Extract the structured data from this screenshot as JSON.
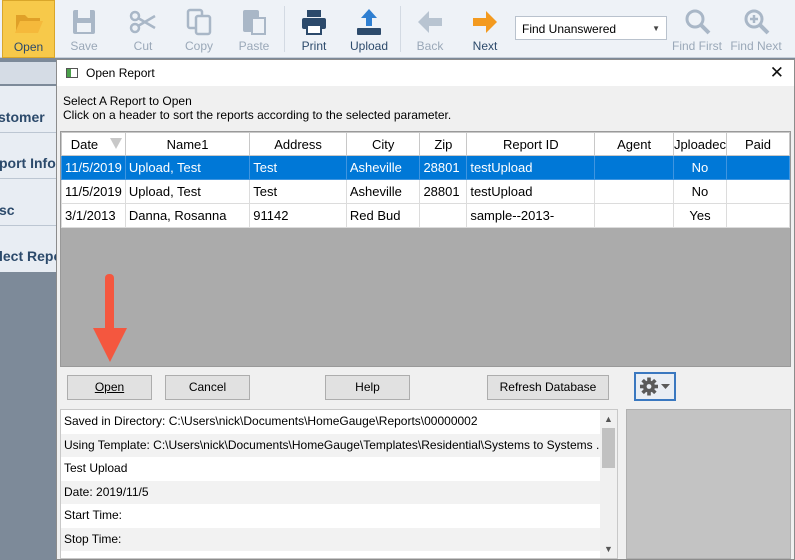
{
  "toolbar": {
    "open": "Open",
    "save": "Save",
    "cut": "Cut",
    "copy": "Copy",
    "paste": "Paste",
    "print": "Print",
    "upload": "Upload",
    "back": "Back",
    "next": "Next",
    "find_select_value": "Find Unanswered",
    "find_first": "Find First",
    "find_next": "Find Next"
  },
  "left_nav": {
    "items": [
      "stomer",
      "port Info",
      "sc",
      "lect Repo"
    ]
  },
  "dialog": {
    "title": "Open Report",
    "instruction_line1": "Select A Report to Open",
    "instruction_line2": "Click on a header to sort the reports according to the selected parameter.",
    "columns": [
      "Date",
      "Name1",
      "Address",
      "City",
      "Zip",
      "Report ID",
      "Agent",
      "Jploadec",
      "Paid"
    ],
    "rows": [
      {
        "date": "11/5/2019",
        "name": "Upload, Test",
        "address": "Test",
        "city": "Asheville",
        "zip": "28801",
        "report_id": "testUpload",
        "agent": "",
        "uploaded": "No",
        "paid": ""
      },
      {
        "date": "11/5/2019",
        "name": "Upload, Test",
        "address": "Test",
        "city": "Asheville",
        "zip": "28801",
        "report_id": "testUpload",
        "agent": "",
        "uploaded": "No",
        "paid": ""
      },
      {
        "date": "3/1/2013",
        "name": "Danna, Rosanna",
        "address": "91142",
        "city": "Red Bud",
        "zip": "",
        "report_id": "sample--2013-",
        "agent": "",
        "uploaded": "Yes",
        "paid": ""
      }
    ],
    "buttons": {
      "open": "Open",
      "cancel": "Cancel",
      "help": "Help",
      "refresh": "Refresh Database"
    },
    "info_lines": [
      "Saved in Directory: C:\\Users\\nick\\Documents\\HomeGauge\\Reports\\00000002",
      "Using Template: C:\\Users\\nick\\Documents\\HomeGauge\\Templates\\Residential\\Systems to Systems ...",
      "Test Upload",
      "Date: 2019/11/5",
      "Start Time:",
      "Stop Time:"
    ]
  },
  "colors": {
    "selection": "#0078d7",
    "annotation_arrow": "#f4573f",
    "open_button_active": "#f7c94a",
    "toolbar_label": "#2c4a6b"
  }
}
